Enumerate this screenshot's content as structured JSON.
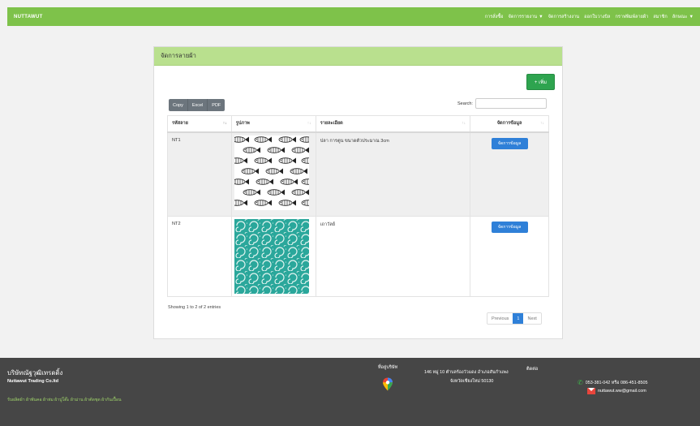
{
  "navbar": {
    "brand": "NUTTAWUT",
    "links": [
      {
        "label": "การสั่งซื้อ",
        "caret": false
      },
      {
        "label": "จัดการรายงาน",
        "caret": true
      },
      {
        "label": "จัดการสร้างงาน",
        "caret": false
      },
      {
        "label": "ออกใบวางบิล",
        "caret": false
      },
      {
        "label": "กราฟพิมพ์ลายผ้า",
        "caret": false
      },
      {
        "label": "สมาชิก",
        "caret": false
      },
      {
        "label": "ลักษณะ",
        "caret": true
      }
    ]
  },
  "card": {
    "title": "จัดการลายผ้า"
  },
  "toolbar": {
    "add_label": "+ เพิ่ม",
    "export_buttons": [
      "Copy",
      "Excel",
      "PDF"
    ],
    "search_label": "Search:",
    "search_value": ""
  },
  "table": {
    "headers": [
      "รหัสลาย",
      "รูปภาพ",
      "รายละเอียด",
      "จัดการข้อมูล"
    ],
    "rows": [
      {
        "code": "NT1",
        "detail": "ปลา การตูน ขนาดตัวประมาณ 3cm",
        "action": "จัดการข้อมูล",
        "image": "fish-pattern-image"
      },
      {
        "code": "NT2",
        "detail": "เถาวัลย์",
        "action": "จัดการข้อมูล",
        "image": "teal-swirl-pattern-image"
      }
    ]
  },
  "info": "Showing 1 to 2 of 2 entries",
  "pagination": {
    "previous": "Previous",
    "current": "1",
    "next": "Next"
  },
  "footer": {
    "company_th": "บริษัทณัฐวุฒิเทรดดิ้ง",
    "company_en": "Nuttawut Trading Co.ltd",
    "tagline": "รับผลิตผ้า ผ้าพันคอ ผ้าห่ม ผ้าปูโต๊ะ ผ้าม่าน ผ้าตัดชุด ผ้ากันเปื้อน",
    "location_label": "ที่อยู่บริษัท",
    "address_line1": "146 หมู่ 10 ตำบลร้องวัวแดง อำเภอสันกำแพง",
    "address_line2": "จังหวัดเชียงใหม่ 50130",
    "contact_label": "ติดต่อ",
    "phone": "053-381-042 หรือ 086-451-8505",
    "email": "nuttawut.ww@gmail.com"
  },
  "colors": {
    "navbar": "#7ec24a",
    "card_header": "#b9e08e",
    "add_button": "#2ea44f",
    "manage_button": "#2f80d8",
    "footer": "#464646"
  }
}
